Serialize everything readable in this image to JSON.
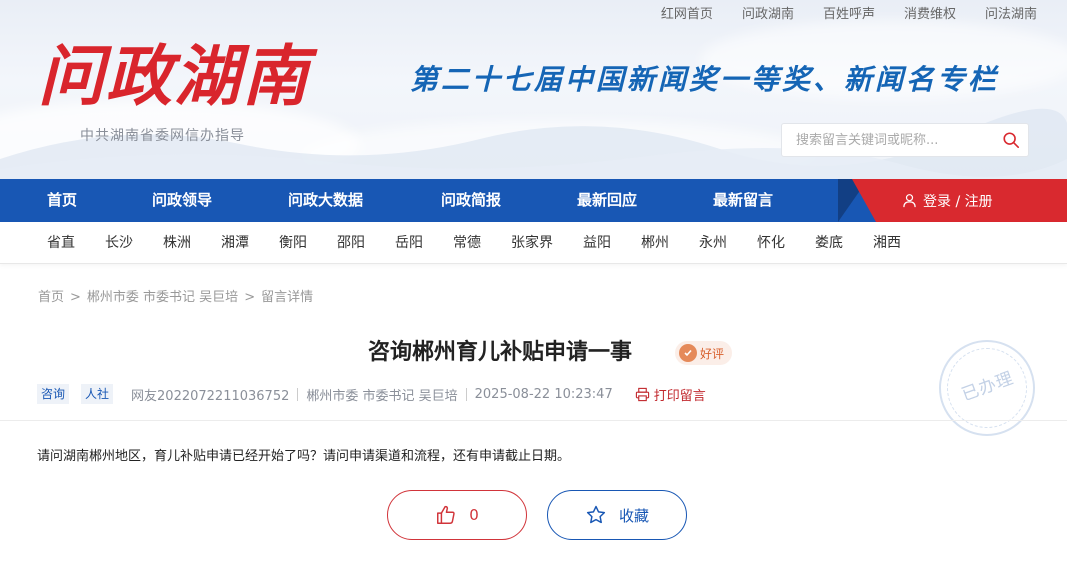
{
  "top_links": [
    "红网首页",
    "问政湖南",
    "百姓呼声",
    "消费维权",
    "问法湖南"
  ],
  "logo": {
    "title": "问政湖南",
    "subtitle": "中共湖南省委网信办指导"
  },
  "slogan": "第二十七届中国新闻奖一等奖、新闻名专栏",
  "search": {
    "placeholder": "搜索留言关键词或昵称..."
  },
  "nav": {
    "items": [
      "首页",
      "问政领导",
      "问政大数据",
      "问政简报",
      "最新回应",
      "最新留言"
    ],
    "login": "登录 / 注册"
  },
  "regions": [
    "省直",
    "长沙",
    "株洲",
    "湘潭",
    "衡阳",
    "邵阳",
    "岳阳",
    "常德",
    "张家界",
    "益阳",
    "郴州",
    "永州",
    "怀化",
    "娄底",
    "湘西"
  ],
  "breadcrumb": [
    "首页",
    "郴州市委 市委书记 吴巨培",
    "留言详情"
  ],
  "post": {
    "title": "咨询郴州育儿补贴申请一事",
    "rating": "好评",
    "status_stamp": "已办理",
    "tags": [
      "咨询",
      "人社"
    ],
    "author": "网友2022072211036752",
    "target": "郴州市委 市委书记 吴巨培",
    "time": "2025-08-22 10:23:47",
    "print_label": "打印留言",
    "content": "请问湖南郴州地区，育儿补贴申请已经开始了吗？请问申请渠道和流程，还有申请截止日期。"
  },
  "actions": {
    "like_count": "0",
    "favorite_label": "收藏"
  },
  "colors": {
    "brand_blue": "#1857b4",
    "brand_red": "#d9292f"
  }
}
